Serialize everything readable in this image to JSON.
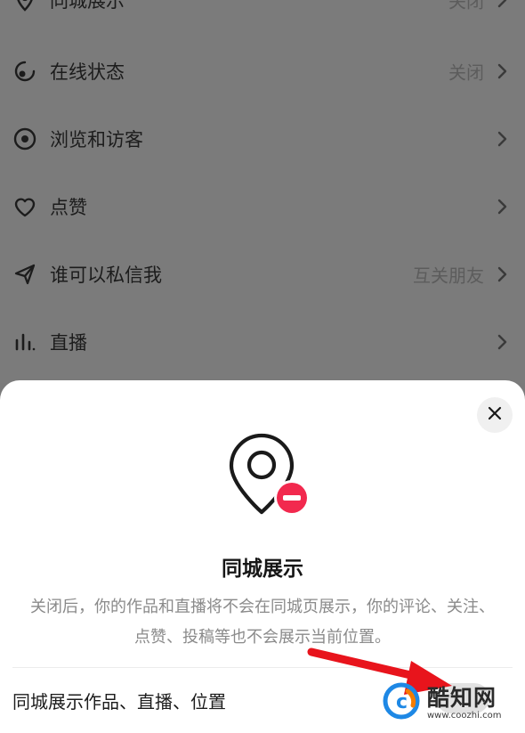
{
  "settings": {
    "items": [
      {
        "label": "同城展示",
        "value": "关闭",
        "icon": "location-pin-icon"
      },
      {
        "label": "在线状态",
        "value": "关闭",
        "icon": "online-status-icon"
      },
      {
        "label": "浏览和访客",
        "value": "",
        "icon": "eye-icon"
      },
      {
        "label": "点赞",
        "value": "",
        "icon": "heart-icon"
      },
      {
        "label": "谁可以私信我",
        "value": "互关朋友",
        "icon": "send-icon"
      },
      {
        "label": "直播",
        "value": "",
        "icon": "bar-chart-icon"
      }
    ]
  },
  "sheet": {
    "title": "同城展示",
    "description": "关闭后，你的作品和直播将不会在同城页展示，你的评论、关注、点赞、投稿等也不会展示当前位置。",
    "option_label": "同城展示作品、直播、位置",
    "option_enabled": false,
    "close_icon": "close-icon",
    "hero_icon": "location-off-icon",
    "accent_color": "#f2294e"
  },
  "watermark": {
    "title": "酷知网",
    "url": "www.coozhi.com"
  }
}
